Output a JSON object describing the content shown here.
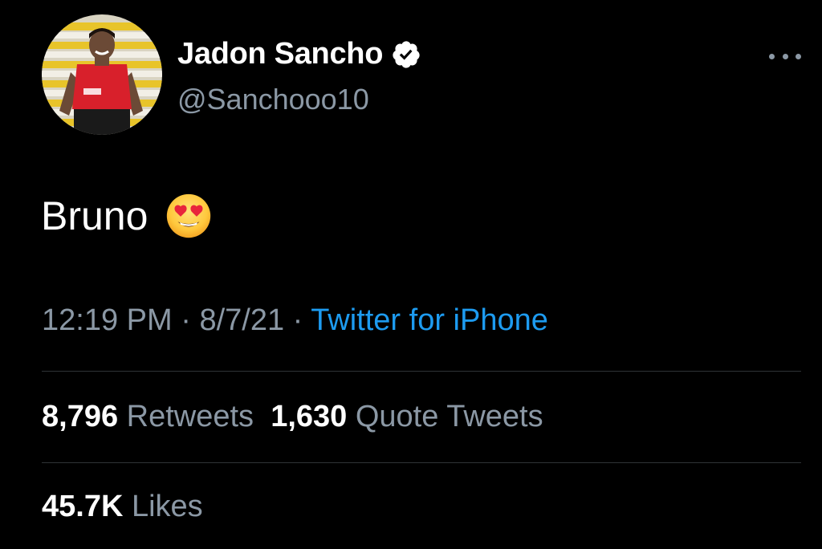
{
  "author": {
    "display_name": "Jadon Sancho",
    "handle": "@Sanchooo10",
    "verified": true
  },
  "tweet": {
    "text": "Bruno",
    "emoji": "smiling-face-with-heart-eyes"
  },
  "meta": {
    "time": "12:19 PM",
    "separator": " · ",
    "date": "8/7/21",
    "source": "Twitter for iPhone"
  },
  "stats": {
    "retweets_count": "8,796",
    "retweets_label": "Retweets",
    "quotes_count": "1,630",
    "quotes_label": "Quote Tweets",
    "likes_count": "45.7K",
    "likes_label": "Likes"
  },
  "colors": {
    "background": "#000000",
    "primary_text": "#ffffff",
    "secondary_text": "#8b98a5",
    "link": "#1d9bf0",
    "divider": "#2f3336"
  },
  "icons": {
    "verified": "verified-badge-icon",
    "more": "more-options-icon"
  }
}
